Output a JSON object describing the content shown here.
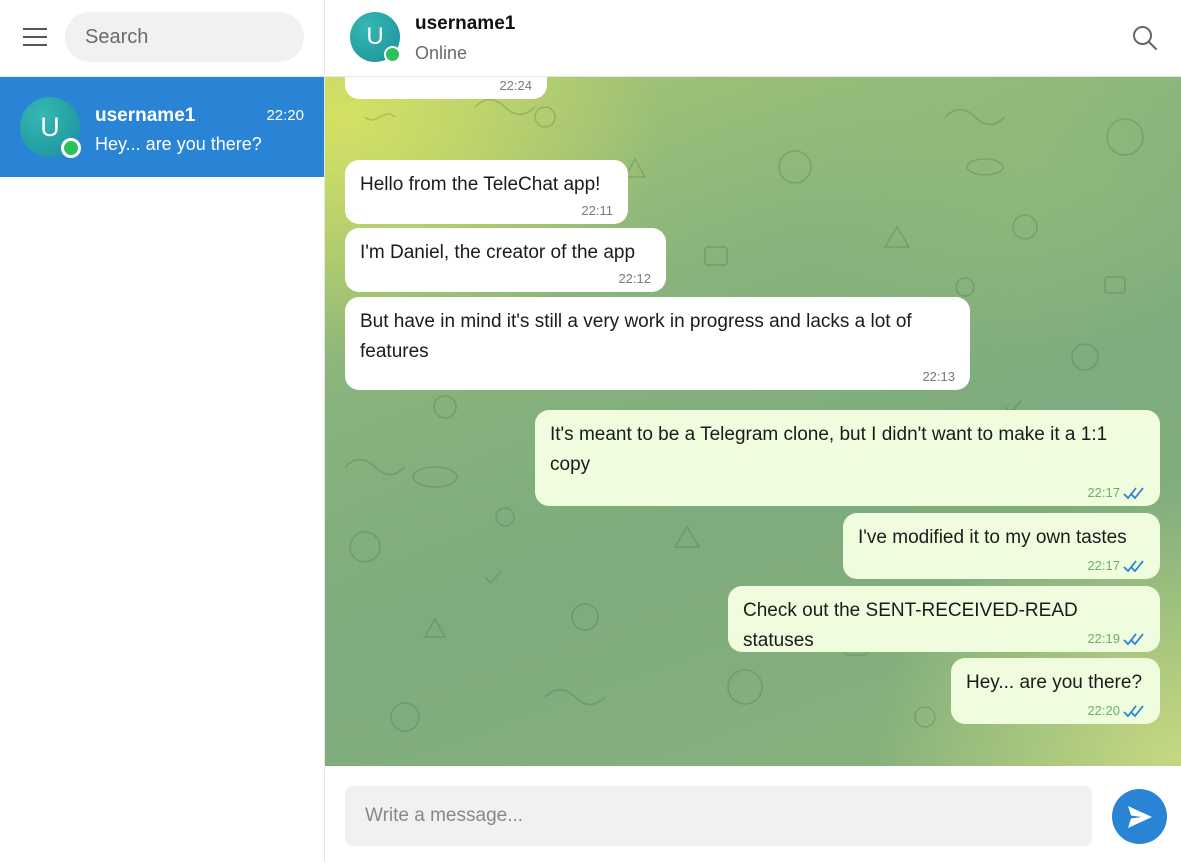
{
  "sidebar": {
    "menu_icon": "hamburger-menu-icon",
    "search_placeholder": "Search",
    "chats": [
      {
        "avatar_letter": "U",
        "name": "username1",
        "time": "22:20",
        "preview": "Hey... are you there?",
        "online": true
      }
    ]
  },
  "header": {
    "avatar_letter": "U",
    "name": "username1",
    "status": "Online",
    "search_icon": "search-icon"
  },
  "messages": [
    {
      "direction": "in",
      "text": "",
      "time": "22:24"
    },
    {
      "direction": "in",
      "text": "Hello from the TeleChat app!",
      "time": "22:11"
    },
    {
      "direction": "in",
      "text": "I'm Daniel, the creator of the app",
      "time": "22:12"
    },
    {
      "direction": "in",
      "text": "But have in mind it's still a very work in progress and lacks a lot of features",
      "time": "22:13"
    },
    {
      "direction": "out",
      "text": "It's meant to be a Telegram clone, but I didn't want to make it a 1:1 copy",
      "time": "22:17",
      "status": "read"
    },
    {
      "direction": "out",
      "text": "I've modified it to my own tastes",
      "time": "22:17",
      "status": "read"
    },
    {
      "direction": "out",
      "text": "Check out the SENT-RECEIVED-READ statuses",
      "time": "22:19",
      "status": "read"
    },
    {
      "direction": "out",
      "text": "Hey... are you there?",
      "time": "22:20",
      "status": "read"
    }
  ],
  "composer": {
    "placeholder": "Write a message...",
    "send_icon": "send-icon"
  },
  "colors": {
    "accent": "#2a84d6",
    "online": "#2ec05a",
    "outgoing_bubble": "#effcdd",
    "incoming_bubble": "#ffffff",
    "read_ticks": "#2a84d6"
  }
}
